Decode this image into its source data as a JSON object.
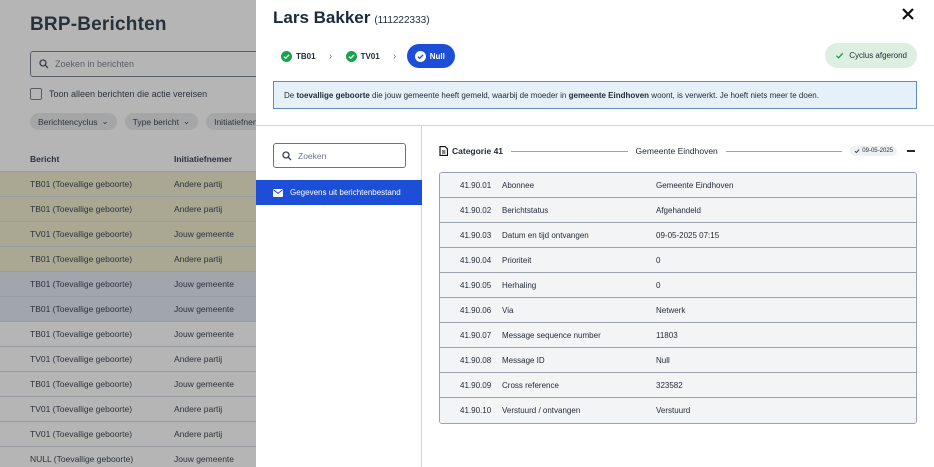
{
  "background": {
    "title": "BRP-Berichten",
    "search_placeholder": "Zoeken in berichten",
    "checkbox_label": "Toon alleen berichten die actie vereisen",
    "filters": [
      "Berichtencyclus",
      "Type bericht",
      "Initiatiefnemer"
    ],
    "columns": [
      "Bericht",
      "Initiatiefnemer"
    ],
    "rows": [
      {
        "bericht": "TB01 (Toevallige geboorte)",
        "initiatiefnemer": "Andere partij"
      },
      {
        "bericht": "TB01 (Toevallige geboorte)",
        "initiatiefnemer": "Andere partij"
      },
      {
        "bericht": "TV01 (Toevallige geboorte)",
        "initiatiefnemer": "Jouw gemeente"
      },
      {
        "bericht": "TB01 (Toevallige geboorte)",
        "initiatiefnemer": "Andere partij"
      },
      {
        "bericht": "TB01 (Toevallige geboorte)",
        "initiatiefnemer": "Jouw gemeente"
      },
      {
        "bericht": "TB01 (Toevallige geboorte)",
        "initiatiefnemer": "Jouw gemeente"
      },
      {
        "bericht": "TB01 (Toevallige geboorte)",
        "initiatiefnemer": "Jouw gemeente"
      },
      {
        "bericht": "TV01 (Toevallige geboorte)",
        "initiatiefnemer": "Andere partij"
      },
      {
        "bericht": "TB01 (Toevallige geboorte)",
        "initiatiefnemer": "Jouw gemeente"
      },
      {
        "bericht": "TV01 (Toevallige geboorte)",
        "initiatiefnemer": "Andere partij"
      },
      {
        "bericht": "TV01 (Toevallige geboorte)",
        "initiatiefnemer": "Andere partij"
      },
      {
        "bericht": "NULL (Toevallige geboorte)",
        "initiatiefnemer": "Jouw gemeente"
      }
    ]
  },
  "drawer": {
    "name": "Lars Bakker",
    "bsn": "(111222333)",
    "steps": [
      "TB01",
      "TV01",
      "Null"
    ],
    "cycle_status": "Cyclus afgerond",
    "info": {
      "p1": "De ",
      "b1": "toevallige geboorte",
      "p2": " die jouw gemeente heeft gemeld, waarbij de moeder in ",
      "b2": "gemeente Eindhoven",
      "p3": " woont, is verwerkt. Je hoeft niets meer te doen."
    },
    "search_placeholder": "Zoeken",
    "nav_item": "Gegevens uit berichtenbestand",
    "category": {
      "title": "Categorie 41",
      "gemeente": "Gemeente Eindhoven",
      "date": "09-05-2025"
    },
    "fields": [
      {
        "code": "41.90.01",
        "label": "Abonnee",
        "value": "Gemeente Eindhoven"
      },
      {
        "code": "41.90.02",
        "label": "Berichtstatus",
        "value": "Afgehandeld"
      },
      {
        "code": "41.90.03",
        "label": "Datum en tijd ontvangen",
        "value": "09-05-2025 07:15"
      },
      {
        "code": "41.90.04",
        "label": "Prioriteit",
        "value": "0"
      },
      {
        "code": "41.90.05",
        "label": "Herhaling",
        "value": "0"
      },
      {
        "code": "41.90.06",
        "label": "Via",
        "value": "Netwerk"
      },
      {
        "code": "41.90.07",
        "label": "Message sequence number",
        "value": "11803"
      },
      {
        "code": "41.90.08",
        "label": "Message ID",
        "value": "Null"
      },
      {
        "code": "41.90.09",
        "label": "Cross reference",
        "value": "323582"
      },
      {
        "code": "41.90.10",
        "label": "Verstuurd / ontvangen",
        "value": "Verstuurd"
      }
    ]
  },
  "colors": {
    "primary": "#1d4ed8",
    "success": "#16a34a",
    "info_bg": "#e6f0f8",
    "highlight_row": "#eee9c8"
  }
}
